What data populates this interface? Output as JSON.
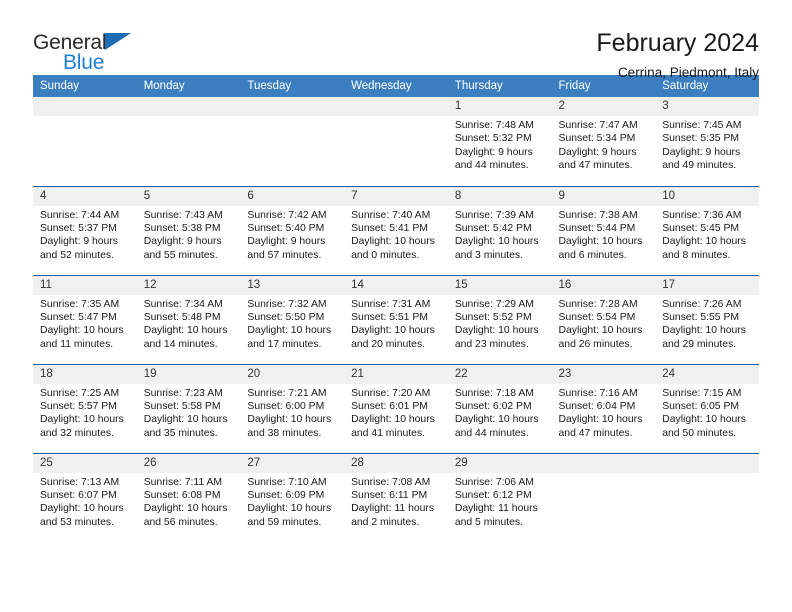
{
  "brand": {
    "name_part1": "General",
    "name_part2": "Blue",
    "accent_color": "#1f7fd4",
    "triangle_color": "#1b6cb5"
  },
  "header": {
    "title": "February 2024",
    "subtitle": "Cerrina, Piedmont, Italy"
  },
  "calendar": {
    "header_bg": "#3c7fc1",
    "row_divider": "#1b5c99",
    "daynum_bg": "#f0f0f0",
    "weekdays": [
      "Sunday",
      "Monday",
      "Tuesday",
      "Wednesday",
      "Thursday",
      "Friday",
      "Saturday"
    ],
    "weeks": [
      [
        {
          "day": "",
          "empty": true
        },
        {
          "day": "",
          "empty": true
        },
        {
          "day": "",
          "empty": true
        },
        {
          "day": "",
          "empty": true
        },
        {
          "day": "1",
          "sunrise": "Sunrise: 7:48 AM",
          "sunset": "Sunset: 5:32 PM",
          "daylight1": "Daylight: 9 hours",
          "daylight2": "and 44 minutes."
        },
        {
          "day": "2",
          "sunrise": "Sunrise: 7:47 AM",
          "sunset": "Sunset: 5:34 PM",
          "daylight1": "Daylight: 9 hours",
          "daylight2": "and 47 minutes."
        },
        {
          "day": "3",
          "sunrise": "Sunrise: 7:45 AM",
          "sunset": "Sunset: 5:35 PM",
          "daylight1": "Daylight: 9 hours",
          "daylight2": "and 49 minutes."
        }
      ],
      [
        {
          "day": "4",
          "sunrise": "Sunrise: 7:44 AM",
          "sunset": "Sunset: 5:37 PM",
          "daylight1": "Daylight: 9 hours",
          "daylight2": "and 52 minutes."
        },
        {
          "day": "5",
          "sunrise": "Sunrise: 7:43 AM",
          "sunset": "Sunset: 5:38 PM",
          "daylight1": "Daylight: 9 hours",
          "daylight2": "and 55 minutes."
        },
        {
          "day": "6",
          "sunrise": "Sunrise: 7:42 AM",
          "sunset": "Sunset: 5:40 PM",
          "daylight1": "Daylight: 9 hours",
          "daylight2": "and 57 minutes."
        },
        {
          "day": "7",
          "sunrise": "Sunrise: 7:40 AM",
          "sunset": "Sunset: 5:41 PM",
          "daylight1": "Daylight: 10 hours",
          "daylight2": "and 0 minutes."
        },
        {
          "day": "8",
          "sunrise": "Sunrise: 7:39 AM",
          "sunset": "Sunset: 5:42 PM",
          "daylight1": "Daylight: 10 hours",
          "daylight2": "and 3 minutes."
        },
        {
          "day": "9",
          "sunrise": "Sunrise: 7:38 AM",
          "sunset": "Sunset: 5:44 PM",
          "daylight1": "Daylight: 10 hours",
          "daylight2": "and 6 minutes."
        },
        {
          "day": "10",
          "sunrise": "Sunrise: 7:36 AM",
          "sunset": "Sunset: 5:45 PM",
          "daylight1": "Daylight: 10 hours",
          "daylight2": "and 8 minutes."
        }
      ],
      [
        {
          "day": "11",
          "sunrise": "Sunrise: 7:35 AM",
          "sunset": "Sunset: 5:47 PM",
          "daylight1": "Daylight: 10 hours",
          "daylight2": "and 11 minutes."
        },
        {
          "day": "12",
          "sunrise": "Sunrise: 7:34 AM",
          "sunset": "Sunset: 5:48 PM",
          "daylight1": "Daylight: 10 hours",
          "daylight2": "and 14 minutes."
        },
        {
          "day": "13",
          "sunrise": "Sunrise: 7:32 AM",
          "sunset": "Sunset: 5:50 PM",
          "daylight1": "Daylight: 10 hours",
          "daylight2": "and 17 minutes."
        },
        {
          "day": "14",
          "sunrise": "Sunrise: 7:31 AM",
          "sunset": "Sunset: 5:51 PM",
          "daylight1": "Daylight: 10 hours",
          "daylight2": "and 20 minutes."
        },
        {
          "day": "15",
          "sunrise": "Sunrise: 7:29 AM",
          "sunset": "Sunset: 5:52 PM",
          "daylight1": "Daylight: 10 hours",
          "daylight2": "and 23 minutes."
        },
        {
          "day": "16",
          "sunrise": "Sunrise: 7:28 AM",
          "sunset": "Sunset: 5:54 PM",
          "daylight1": "Daylight: 10 hours",
          "daylight2": "and 26 minutes."
        },
        {
          "day": "17",
          "sunrise": "Sunrise: 7:26 AM",
          "sunset": "Sunset: 5:55 PM",
          "daylight1": "Daylight: 10 hours",
          "daylight2": "and 29 minutes."
        }
      ],
      [
        {
          "day": "18",
          "sunrise": "Sunrise: 7:25 AM",
          "sunset": "Sunset: 5:57 PM",
          "daylight1": "Daylight: 10 hours",
          "daylight2": "and 32 minutes."
        },
        {
          "day": "19",
          "sunrise": "Sunrise: 7:23 AM",
          "sunset": "Sunset: 5:58 PM",
          "daylight1": "Daylight: 10 hours",
          "daylight2": "and 35 minutes."
        },
        {
          "day": "20",
          "sunrise": "Sunrise: 7:21 AM",
          "sunset": "Sunset: 6:00 PM",
          "daylight1": "Daylight: 10 hours",
          "daylight2": "and 38 minutes."
        },
        {
          "day": "21",
          "sunrise": "Sunrise: 7:20 AM",
          "sunset": "Sunset: 6:01 PM",
          "daylight1": "Daylight: 10 hours",
          "daylight2": "and 41 minutes."
        },
        {
          "day": "22",
          "sunrise": "Sunrise: 7:18 AM",
          "sunset": "Sunset: 6:02 PM",
          "daylight1": "Daylight: 10 hours",
          "daylight2": "and 44 minutes."
        },
        {
          "day": "23",
          "sunrise": "Sunrise: 7:16 AM",
          "sunset": "Sunset: 6:04 PM",
          "daylight1": "Daylight: 10 hours",
          "daylight2": "and 47 minutes."
        },
        {
          "day": "24",
          "sunrise": "Sunrise: 7:15 AM",
          "sunset": "Sunset: 6:05 PM",
          "daylight1": "Daylight: 10 hours",
          "daylight2": "and 50 minutes."
        }
      ],
      [
        {
          "day": "25",
          "sunrise": "Sunrise: 7:13 AM",
          "sunset": "Sunset: 6:07 PM",
          "daylight1": "Daylight: 10 hours",
          "daylight2": "and 53 minutes."
        },
        {
          "day": "26",
          "sunrise": "Sunrise: 7:11 AM",
          "sunset": "Sunset: 6:08 PM",
          "daylight1": "Daylight: 10 hours",
          "daylight2": "and 56 minutes."
        },
        {
          "day": "27",
          "sunrise": "Sunrise: 7:10 AM",
          "sunset": "Sunset: 6:09 PM",
          "daylight1": "Daylight: 10 hours",
          "daylight2": "and 59 minutes."
        },
        {
          "day": "28",
          "sunrise": "Sunrise: 7:08 AM",
          "sunset": "Sunset: 6:11 PM",
          "daylight1": "Daylight: 11 hours",
          "daylight2": "and 2 minutes."
        },
        {
          "day": "29",
          "sunrise": "Sunrise: 7:06 AM",
          "sunset": "Sunset: 6:12 PM",
          "daylight1": "Daylight: 11 hours",
          "daylight2": "and 5 minutes."
        },
        {
          "day": "",
          "empty": true
        },
        {
          "day": "",
          "empty": true
        }
      ]
    ]
  }
}
